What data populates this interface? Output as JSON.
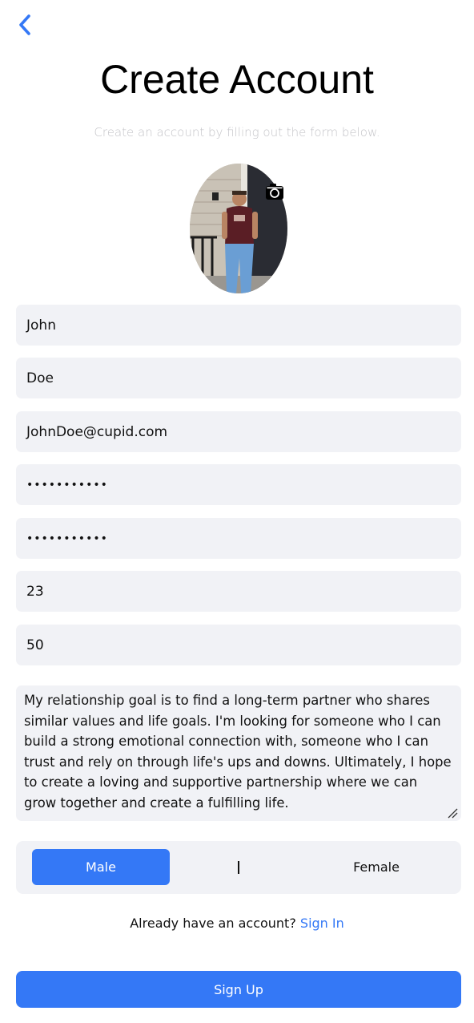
{
  "header": {
    "back_icon": "chevron-left-icon",
    "title": "Create Account",
    "subtitle": "Create an account by filling out the form below."
  },
  "profile_photo": {
    "camera_icon": "camera-icon"
  },
  "form": {
    "first_name": "John",
    "last_name": "Doe",
    "email": "JohnDoe@cupid.com",
    "password": "•••••••••••",
    "confirm_password": "•••••••••••",
    "age": "23",
    "field_7": "50",
    "relationship_goal": "My relationship goal is to find a long-term partner who shares similar values and life goals. I'm looking for someone who I can build a strong emotional connection with, someone who I can trust and rely on through life's ups and downs. Ultimately, I hope to create a loving and supportive partnership where we can grow together and create a fulfilling life."
  },
  "gender": {
    "male": "Male",
    "female": "Female",
    "selected": "Male"
  },
  "signin": {
    "prompt": "Already have an account?",
    "link": "Sign In"
  },
  "signup_button": "Sign Up",
  "colors": {
    "accent": "#3478f6",
    "field_bg": "#f1f2f6",
    "subtitle": "#c4c4c8"
  }
}
